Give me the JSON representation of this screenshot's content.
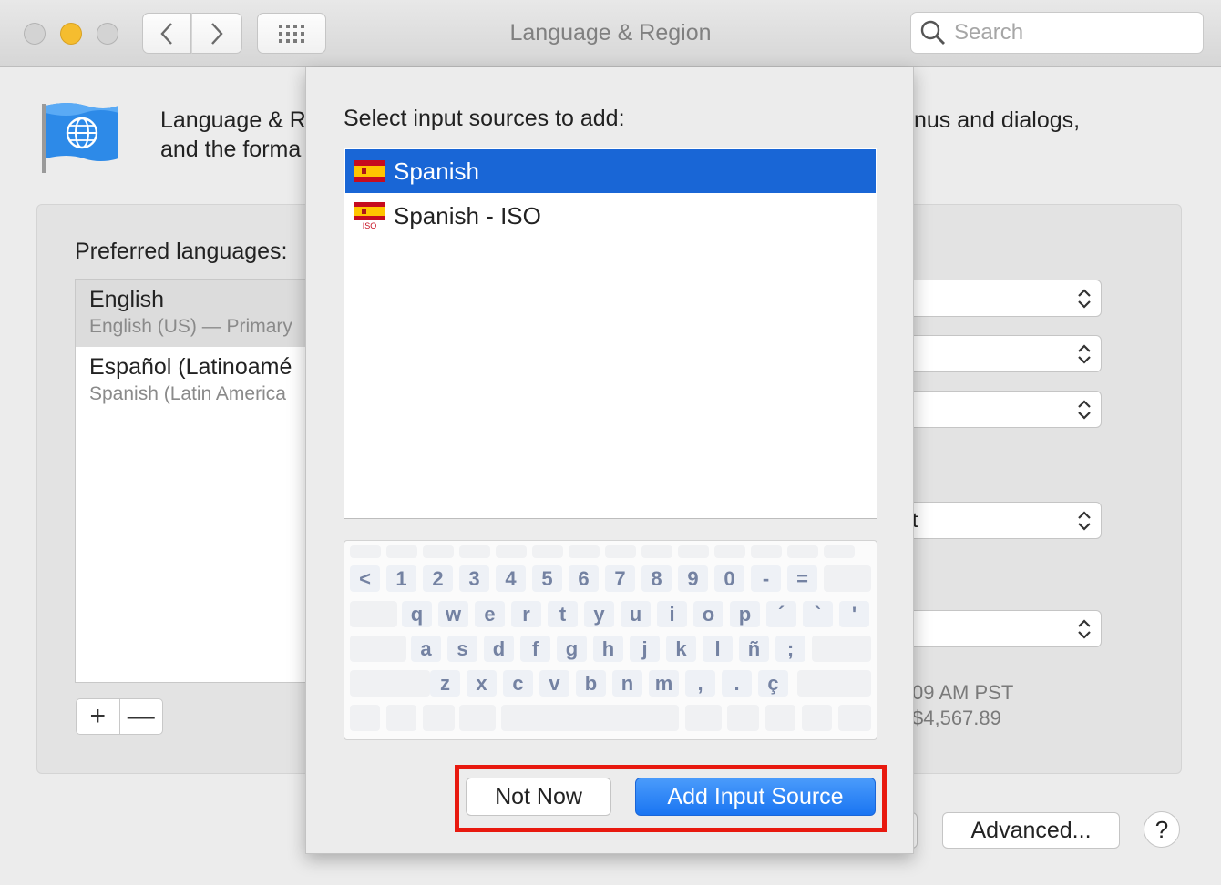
{
  "window": {
    "title": "Language & Region",
    "search_placeholder": "Search"
  },
  "header": {
    "line1_left": "Language & R",
    "line1_right": "nus and dialogs,",
    "line2_left": "and the forma"
  },
  "preferred": {
    "label": "Preferred languages:",
    "languages": [
      {
        "name": "English",
        "detail": "English (US) — Primary"
      },
      {
        "name": "Español (Latinoamé",
        "detail": "Spanish (Latin America"
      }
    ],
    "add_label": "+",
    "remove_label": "—"
  },
  "right_panel": {
    "popup_partial_value": "t",
    "time_sample": "09 AM PST",
    "number_sample": "$4,567.89"
  },
  "footer": {
    "advanced_label": "Advanced...",
    "help_label": "?"
  },
  "sheet": {
    "heading": "Select input sources to add:",
    "sources": [
      {
        "name": "Spanish",
        "selected": true
      },
      {
        "name": "Spanish - ISO",
        "selected": false,
        "flag_caption": "ISO"
      }
    ],
    "keyboard": {
      "row1": [
        "<",
        "1",
        "2",
        "3",
        "4",
        "5",
        "6",
        "7",
        "8",
        "9",
        "0",
        "-",
        "="
      ],
      "row2": [
        "q",
        "w",
        "e",
        "r",
        "t",
        "y",
        "u",
        "i",
        "o",
        "p",
        "´",
        "`",
        "'"
      ],
      "row3": [
        "a",
        "s",
        "d",
        "f",
        "g",
        "h",
        "j",
        "k",
        "l",
        "ñ",
        ";"
      ],
      "row4": [
        "z",
        "x",
        "c",
        "v",
        "b",
        "n",
        "m",
        ",",
        ".",
        "ç"
      ]
    },
    "not_now_label": "Not Now",
    "add_label": "Add Input Source"
  },
  "colors": {
    "selection_blue": "#1966d6",
    "primary_button": "#1a75f2",
    "highlight_red": "#e8190f",
    "key_text": "#7482a2"
  },
  "icons": [
    "back-chevron-icon",
    "forward-chevron-icon",
    "grid-icon",
    "search-icon",
    "globe-flag-icon",
    "spain-flag-icon",
    "updown-chevron-icon"
  ]
}
